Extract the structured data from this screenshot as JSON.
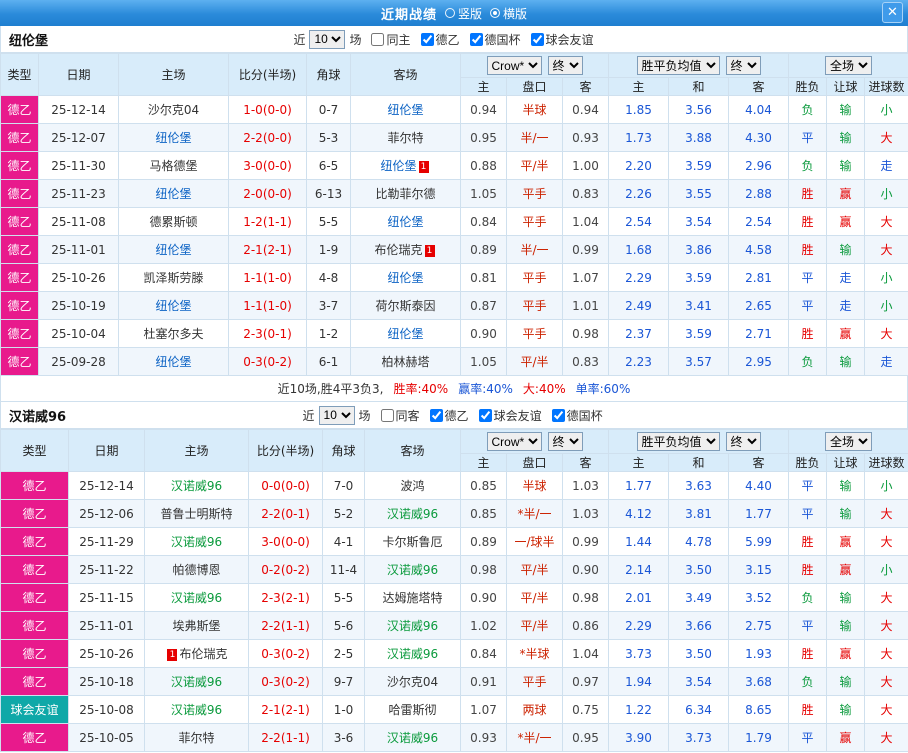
{
  "titlebar": {
    "title": "近期战绩",
    "radio_options": [
      {
        "label": "竖版",
        "selected": false
      },
      {
        "label": "横版",
        "selected": true
      }
    ],
    "close_label": "✕"
  },
  "colors": {
    "type_colors": {
      "德乙": "#e81a8c",
      "球会友谊": "#0fa8a8"
    },
    "accent_red": "#e60000",
    "accent_blue": "#1a56d6",
    "accent_green": "#0a9a3c",
    "team_home_highlight": "#0b62c4",
    "team_away_highlight": "#0a9a3c"
  },
  "result_color_map": {
    "胜": "red",
    "赢": "red",
    "大": "red",
    "平": "blue",
    "走": "blue",
    "负": "green",
    "输": "green",
    "小": "green"
  },
  "sections": [
    {
      "team": "纽伦堡",
      "filter": {
        "near": "近",
        "count": "10",
        "unit": "场",
        "same": "同主",
        "same_checked": false,
        "leagues": [
          "德乙",
          "德国杯",
          "球会友谊"
        ]
      },
      "columns": {
        "type": "类型",
        "date": "日期",
        "home": "主场",
        "score": "比分(半场)",
        "corner": "角球",
        "away": "客场",
        "odds_home": "主",
        "handicap": "盘口",
        "odds_away": "客",
        "avg_home": "主",
        "avg_draw": "和",
        "avg_away": "客",
        "result": "胜负",
        "handicap_result": "让球",
        "goals_result": "进球数"
      },
      "selects": {
        "company": "Crow*",
        "company_final": "终",
        "avg": "胜平负均值",
        "avg_final": "终",
        "scope": "全场"
      },
      "rows": [
        {
          "type": "德乙",
          "date": "25-12-14",
          "home": {
            "name": "沙尔克04"
          },
          "score": "1-0(0-0)",
          "corner": "0-7",
          "away": {
            "name": "纽伦堡",
            "hl": "blue"
          },
          "crow": [
            "0.94",
            "半球",
            "0.94"
          ],
          "avg": [
            "1.85",
            "3.56",
            "4.04"
          ],
          "results": [
            "负",
            "输",
            "小"
          ]
        },
        {
          "type": "德乙",
          "date": "25-12-07",
          "home": {
            "name": "纽伦堡",
            "hl": "blue"
          },
          "score": "2-2(0-0)",
          "corner": "5-3",
          "away": {
            "name": "菲尔特"
          },
          "crow": [
            "0.95",
            "半/一",
            "0.93"
          ],
          "avg": [
            "1.73",
            "3.88",
            "4.30"
          ],
          "results": [
            "平",
            "输",
            "大"
          ]
        },
        {
          "type": "德乙",
          "date": "25-11-30",
          "home": {
            "name": "马格德堡"
          },
          "score": "3-0(0-0)",
          "corner": "6-5",
          "away": {
            "name": "纽伦堡",
            "hl": "blue",
            "badge": "1"
          },
          "crow": [
            "0.88",
            "平/半",
            "1.00"
          ],
          "avg": [
            "2.20",
            "3.59",
            "2.96"
          ],
          "results": [
            "负",
            "输",
            "走"
          ]
        },
        {
          "type": "德乙",
          "date": "25-11-23",
          "home": {
            "name": "纽伦堡",
            "hl": "blue"
          },
          "score": "2-0(0-0)",
          "corner": "6-13",
          "away": {
            "name": "比勒菲尔德"
          },
          "crow": [
            "1.05",
            "平手",
            "0.83"
          ],
          "avg": [
            "2.26",
            "3.55",
            "2.88"
          ],
          "results": [
            "胜",
            "赢",
            "小"
          ]
        },
        {
          "type": "德乙",
          "date": "25-11-08",
          "home": {
            "name": "德累斯顿"
          },
          "score": "1-2(1-1)",
          "corner": "5-5",
          "away": {
            "name": "纽伦堡",
            "hl": "blue"
          },
          "crow": [
            "0.84",
            "平手",
            "1.04"
          ],
          "avg": [
            "2.54",
            "3.54",
            "2.54"
          ],
          "results": [
            "胜",
            "赢",
            "大"
          ]
        },
        {
          "type": "德乙",
          "date": "25-11-01",
          "home": {
            "name": "纽伦堡",
            "hl": "blue"
          },
          "score": "2-1(2-1)",
          "corner": "1-9",
          "away": {
            "name": "布伦瑞克",
            "badge": "1"
          },
          "crow": [
            "0.89",
            "半/一",
            "0.99"
          ],
          "avg": [
            "1.68",
            "3.86",
            "4.58"
          ],
          "results": [
            "胜",
            "输",
            "大"
          ]
        },
        {
          "type": "德乙",
          "date": "25-10-26",
          "home": {
            "name": "凯泽斯劳滕"
          },
          "score": "1-1(1-0)",
          "corner": "4-8",
          "away": {
            "name": "纽伦堡",
            "hl": "blue"
          },
          "crow": [
            "0.81",
            "平手",
            "1.07"
          ],
          "avg": [
            "2.29",
            "3.59",
            "2.81"
          ],
          "results": [
            "平",
            "走",
            "小"
          ]
        },
        {
          "type": "德乙",
          "date": "25-10-19",
          "home": {
            "name": "纽伦堡",
            "hl": "blue"
          },
          "score": "1-1(1-0)",
          "corner": "3-7",
          "away": {
            "name": "荷尔斯泰因"
          },
          "crow": [
            "0.87",
            "平手",
            "1.01"
          ],
          "avg": [
            "2.49",
            "3.41",
            "2.65"
          ],
          "results": [
            "平",
            "走",
            "小"
          ]
        },
        {
          "type": "德乙",
          "date": "25-10-04",
          "home": {
            "name": "杜塞尔多夫"
          },
          "score": "2-3(0-1)",
          "corner": "1-2",
          "away": {
            "name": "纽伦堡",
            "hl": "blue"
          },
          "crow": [
            "0.90",
            "平手",
            "0.98"
          ],
          "avg": [
            "2.37",
            "3.59",
            "2.71"
          ],
          "results": [
            "胜",
            "赢",
            "大"
          ]
        },
        {
          "type": "德乙",
          "date": "25-09-28",
          "home": {
            "name": "纽伦堡",
            "hl": "blue"
          },
          "score": "0-3(0-2)",
          "corner": "6-1",
          "away": {
            "name": "柏林赫塔"
          },
          "crow": [
            "1.05",
            "平/半",
            "0.83"
          ],
          "avg": [
            "2.23",
            "3.57",
            "2.95"
          ],
          "results": [
            "负",
            "输",
            "走"
          ]
        }
      ],
      "summary": [
        {
          "text": "近10场,胜4平3负3,",
          "color": "#333333"
        },
        {
          "text": "胜率:40%",
          "color": "#e60000"
        },
        {
          "text": "赢率:40%",
          "color": "#1a56d6"
        },
        {
          "text": "大:40%",
          "color": "#e60000"
        },
        {
          "text": "单率:60%",
          "color": "#1a56d6"
        }
      ]
    },
    {
      "team": "汉诺威96",
      "filter": {
        "near": "近",
        "count": "10",
        "unit": "场",
        "same": "同客",
        "same_checked": false,
        "leagues": [
          "德乙",
          "球会友谊",
          "德国杯"
        ]
      },
      "columns": {
        "type": "类型",
        "date": "日期",
        "home": "主场",
        "score": "比分(半场)",
        "corner": "角球",
        "away": "客场",
        "odds_home": "主",
        "handicap": "盘口",
        "odds_away": "客",
        "avg_home": "主",
        "avg_draw": "和",
        "avg_away": "客",
        "result": "胜负",
        "handicap_result": "让球",
        "goals_result": "进球数"
      },
      "selects": {
        "company": "Crow*",
        "company_final": "终",
        "avg": "胜平负均值",
        "avg_final": "终",
        "scope": "全场"
      },
      "rows": [
        {
          "type": "德乙",
          "date": "25-12-14",
          "home": {
            "name": "汉诺威96",
            "hl": "green"
          },
          "score": "0-0(0-0)",
          "corner": "7-0",
          "away": {
            "name": "波鸿"
          },
          "crow": [
            "0.85",
            "半球",
            "1.03"
          ],
          "avg": [
            "1.77",
            "3.63",
            "4.40"
          ],
          "results": [
            "平",
            "输",
            "小"
          ]
        },
        {
          "type": "德乙",
          "date": "25-12-06",
          "home": {
            "name": "普鲁士明斯特"
          },
          "score": "2-2(0-1)",
          "corner": "5-2",
          "away": {
            "name": "汉诺威96",
            "hl": "green"
          },
          "crow": [
            "0.85",
            "*半/一",
            "1.03"
          ],
          "avg": [
            "4.12",
            "3.81",
            "1.77"
          ],
          "results": [
            "平",
            "输",
            "大"
          ]
        },
        {
          "type": "德乙",
          "date": "25-11-29",
          "home": {
            "name": "汉诺威96",
            "hl": "green"
          },
          "score": "3-0(0-0)",
          "corner": "4-1",
          "away": {
            "name": "卡尔斯鲁厄"
          },
          "crow": [
            "0.89",
            "一/球半",
            "0.99"
          ],
          "avg": [
            "1.44",
            "4.78",
            "5.99"
          ],
          "results": [
            "胜",
            "赢",
            "大"
          ]
        },
        {
          "type": "德乙",
          "date": "25-11-22",
          "home": {
            "name": "帕德博恩"
          },
          "score": "0-2(0-2)",
          "corner": "11-4",
          "away": {
            "name": "汉诺威96",
            "hl": "green"
          },
          "crow": [
            "0.98",
            "平/半",
            "0.90"
          ],
          "avg": [
            "2.14",
            "3.50",
            "3.15"
          ],
          "results": [
            "胜",
            "赢",
            "小"
          ]
        },
        {
          "type": "德乙",
          "date": "25-11-15",
          "home": {
            "name": "汉诺威96",
            "hl": "green"
          },
          "score": "2-3(2-1)",
          "corner": "5-5",
          "away": {
            "name": "达姆施塔特"
          },
          "crow": [
            "0.90",
            "平/半",
            "0.98"
          ],
          "avg": [
            "2.01",
            "3.49",
            "3.52"
          ],
          "results": [
            "负",
            "输",
            "大"
          ]
        },
        {
          "type": "德乙",
          "date": "25-11-01",
          "home": {
            "name": "埃弗斯堡"
          },
          "score": "2-2(1-1)",
          "corner": "5-6",
          "away": {
            "name": "汉诺威96",
            "hl": "green"
          },
          "crow": [
            "1.02",
            "平/半",
            "0.86"
          ],
          "avg": [
            "2.29",
            "3.66",
            "2.75"
          ],
          "results": [
            "平",
            "输",
            "大"
          ]
        },
        {
          "type": "德乙",
          "date": "25-10-26",
          "home": {
            "name": "布伦瑞克",
            "badge": "1",
            "badge_pos": "before"
          },
          "score": "0-3(0-2)",
          "corner": "2-5",
          "away": {
            "name": "汉诺威96",
            "hl": "green"
          },
          "crow": [
            "0.84",
            "*半球",
            "1.04"
          ],
          "avg": [
            "3.73",
            "3.50",
            "1.93"
          ],
          "results": [
            "胜",
            "赢",
            "大"
          ]
        },
        {
          "type": "德乙",
          "date": "25-10-18",
          "home": {
            "name": "汉诺威96",
            "hl": "green"
          },
          "score": "0-3(0-2)",
          "corner": "9-7",
          "away": {
            "name": "沙尔克04"
          },
          "crow": [
            "0.91",
            "平手",
            "0.97"
          ],
          "avg": [
            "1.94",
            "3.54",
            "3.68"
          ],
          "results": [
            "负",
            "输",
            "大"
          ]
        },
        {
          "type": "球会友谊",
          "date": "25-10-08",
          "home": {
            "name": "汉诺威96",
            "hl": "green"
          },
          "score": "2-1(2-1)",
          "corner": "1-0",
          "away": {
            "name": "哈雷斯彻"
          },
          "crow": [
            "1.07",
            "两球",
            "0.75"
          ],
          "avg": [
            "1.22",
            "6.34",
            "8.65"
          ],
          "results": [
            "胜",
            "输",
            "大"
          ]
        },
        {
          "type": "德乙",
          "date": "25-10-05",
          "home": {
            "name": "菲尔特"
          },
          "score": "2-2(1-1)",
          "corner": "3-6",
          "away": {
            "name": "汉诺威96",
            "hl": "green"
          },
          "crow": [
            "0.93",
            "*半/一",
            "0.95"
          ],
          "avg": [
            "3.90",
            "3.73",
            "1.79"
          ],
          "results": [
            "平",
            "赢",
            "大"
          ]
        }
      ]
    }
  ]
}
